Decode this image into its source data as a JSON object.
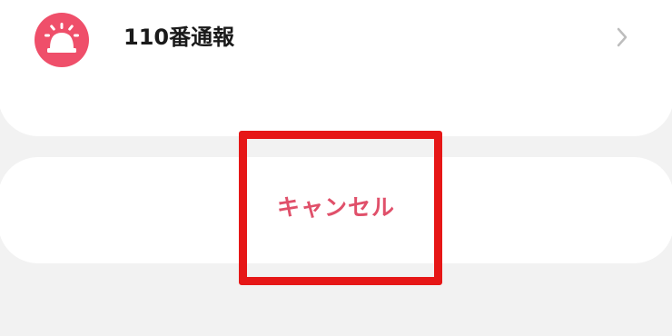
{
  "menu": {
    "items": [
      {
        "label": "110番通報",
        "icon": "siren-icon",
        "icon_color": "#ef4f6a",
        "trailing_icon": "chevron-right-icon"
      }
    ]
  },
  "cancel": {
    "label": "キャンセル",
    "color": "#e0506a"
  },
  "highlight": {
    "color": "#e61717"
  }
}
